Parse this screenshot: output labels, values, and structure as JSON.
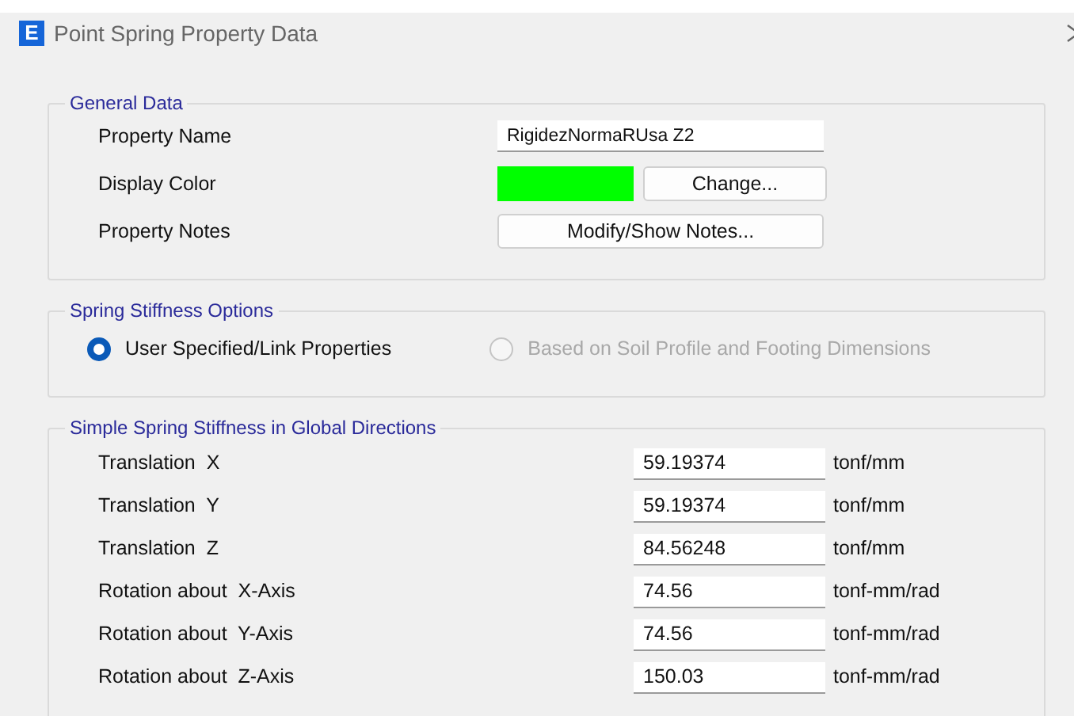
{
  "window": {
    "title": "Point Spring Property Data",
    "icon_text": "E"
  },
  "general_data": {
    "title": "General Data",
    "property_name": {
      "label": "Property Name",
      "value": "RigidezNormaRUsa Z2"
    },
    "display_color": {
      "label": "Display Color",
      "color": "#00ff00",
      "button": "Change..."
    },
    "property_notes": {
      "label": "Property Notes",
      "button": "Modify/Show Notes..."
    }
  },
  "spring_stiffness_options": {
    "title": "Spring Stiffness Options",
    "options": [
      {
        "label": "User Specified/Link Properties",
        "selected": true,
        "disabled": false
      },
      {
        "label": "Based on Soil Profile and Footing Dimensions",
        "selected": false,
        "disabled": true
      }
    ]
  },
  "simple_spring_stiffness": {
    "title": "Simple Spring Stiffness in Global Directions",
    "rows": [
      {
        "label": "Translation  X",
        "value": "59.19374",
        "unit": "tonf/mm"
      },
      {
        "label": "Translation  Y",
        "value": "59.19374",
        "unit": "tonf/mm"
      },
      {
        "label": "Translation  Z",
        "value": "84.56248",
        "unit": "tonf/mm"
      },
      {
        "label": "Rotation about  X-Axis",
        "value": "74.56",
        "unit": "tonf-mm/rad"
      },
      {
        "label": "Rotation about  Y-Axis",
        "value": "74.56",
        "unit": "tonf-mm/rad"
      },
      {
        "label": "Rotation about  Z-Axis",
        "value": "150.03",
        "unit": "tonf-mm/rad"
      }
    ]
  }
}
